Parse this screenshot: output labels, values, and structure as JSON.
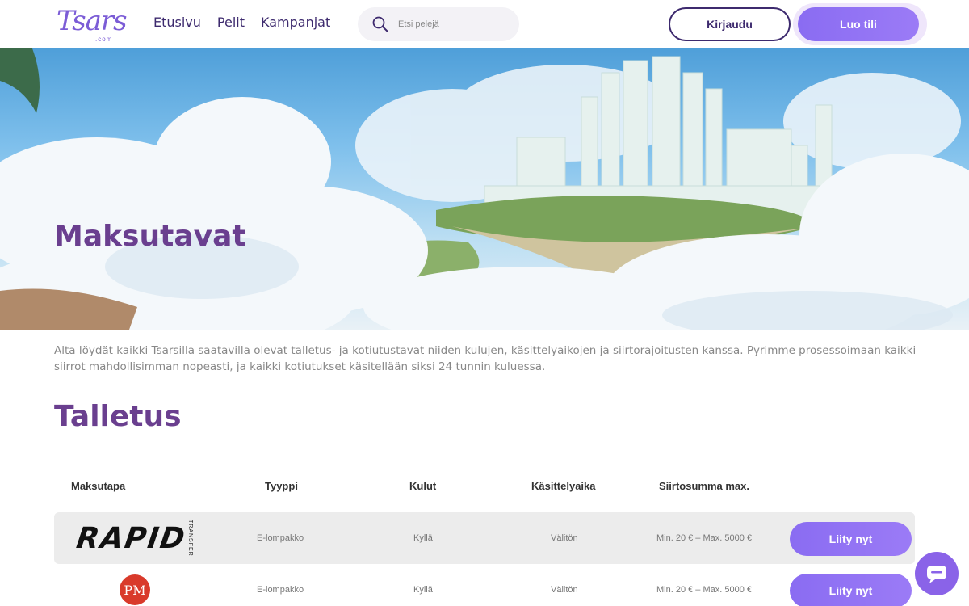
{
  "header": {
    "logo_text": "Tsars",
    "logo_sub": ".com",
    "nav": [
      "Etusivu",
      "Pelit",
      "Kampanjat"
    ],
    "search_placeholder": "Etsi pelejä",
    "login_label": "Kirjaudu",
    "register_label": "Luo tili"
  },
  "hero": {
    "title": "Maksutavat"
  },
  "intro": "Alta löydät kaikki Tsarsilla saatavilla olevat talletus- ja kotiutustavat niiden kulujen, käsittelyaikojen ja siirtorajoitusten kanssa. Pyrimme prosessoimaan kaikki siirrot mahdollisimman nopeasti, ja kaikki kotiutukset käsitellään siksi 24 tunnin kuluessa.",
  "deposit": {
    "title": "Talletus",
    "columns": [
      "Maksutapa",
      "Tyyppi",
      "Kulut",
      "Käsittelyaika",
      "Siirtosumma max."
    ],
    "rows": [
      {
        "logo_text": "RAPID",
        "logo_sub": "TRANSFER",
        "type": "E-lompakko",
        "fees": "Kyllä",
        "time": "Välitön",
        "limits": "Min. 20 € – Max. 5000 €",
        "button": "Liity nyt"
      },
      {
        "logo_text": "PM",
        "type": "E-lompakko",
        "fees": "Kyllä",
        "time": "Välitön",
        "limits": "Min. 20 € – Max. 5000 €",
        "button": "Liity nyt"
      }
    ]
  },
  "icons": {
    "search": "search-icon",
    "chat": "chat-icon"
  },
  "colors": {
    "brand_purple": "#6a3f8f",
    "button_gradient_start": "#8a6cf2",
    "button_gradient_end": "#9b7bf6"
  }
}
